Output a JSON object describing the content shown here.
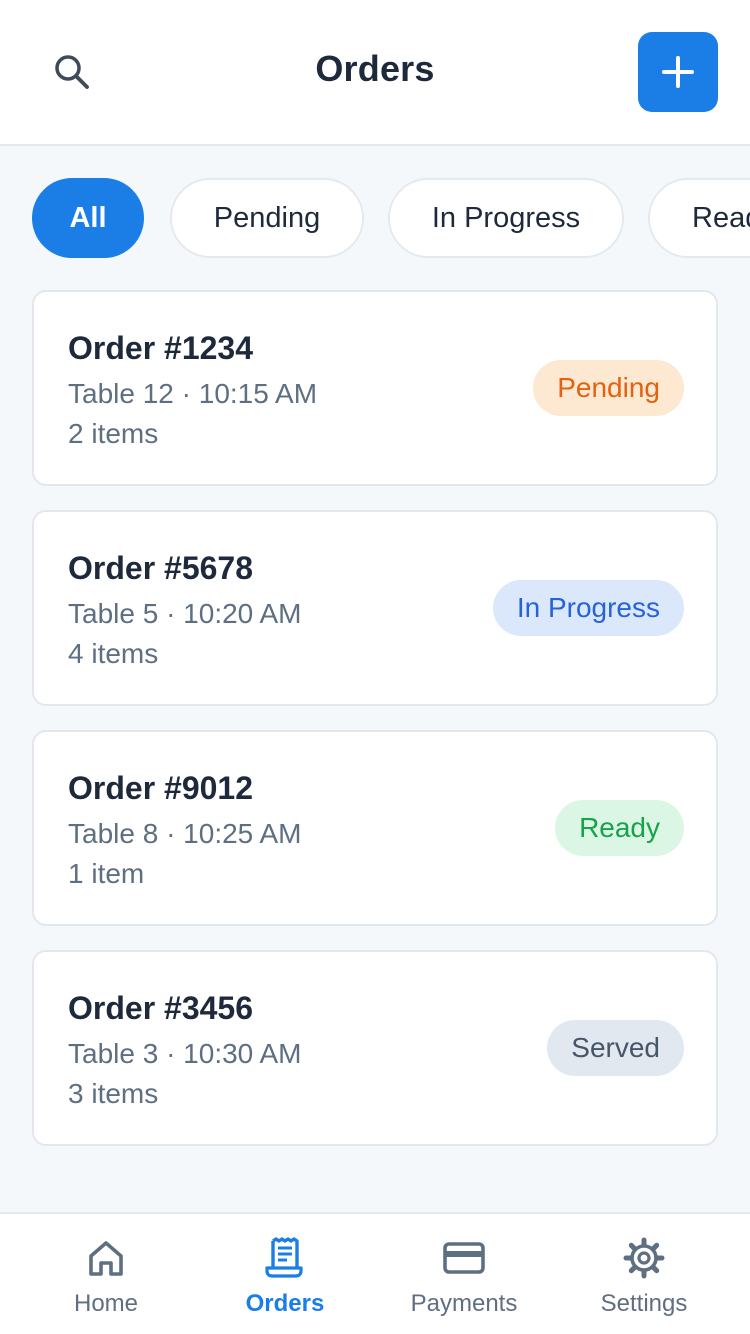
{
  "header": {
    "title": "Orders",
    "search_icon": "search-icon",
    "add_icon": "plus-icon"
  },
  "filters": [
    {
      "label": "All",
      "active": true
    },
    {
      "label": "Pending",
      "active": false
    },
    {
      "label": "In Progress",
      "active": false
    },
    {
      "label": "Ready",
      "active": false
    }
  ],
  "orders": [
    {
      "title": "Order #1234",
      "meta": "Table 12 · 10:15 AM",
      "items": "2 items",
      "status": "Pending",
      "status_bg": "#fde8d2",
      "status_color": "#e2620f"
    },
    {
      "title": "Order #5678",
      "meta": "Table 5 · 10:20 AM",
      "items": "4 items",
      "status": "In Progress",
      "status_bg": "#dbe8fb",
      "status_color": "#2563d6"
    },
    {
      "title": "Order #9012",
      "meta": "Table 8 · 10:25 AM",
      "items": "1 item",
      "status": "Ready",
      "status_bg": "#dcf6e5",
      "status_color": "#16a34a"
    },
    {
      "title": "Order #3456",
      "meta": "Table 3 · 10:30 AM",
      "items": "3 items",
      "status": "Served",
      "status_bg": "#e2e8f0",
      "status_color": "#475569"
    }
  ],
  "nav": [
    {
      "label": "Home",
      "icon": "home-icon",
      "active": false
    },
    {
      "label": "Orders",
      "icon": "receipt-icon",
      "active": true
    },
    {
      "label": "Payments",
      "icon": "credit-card-icon",
      "active": false
    },
    {
      "label": "Settings",
      "icon": "gear-icon",
      "active": false
    }
  ],
  "colors": {
    "accent": "#1a7ee6",
    "background": "#f5f8fb",
    "muted_text": "#5f6f82",
    "nav_icon_inactive": "#5f6f82"
  }
}
